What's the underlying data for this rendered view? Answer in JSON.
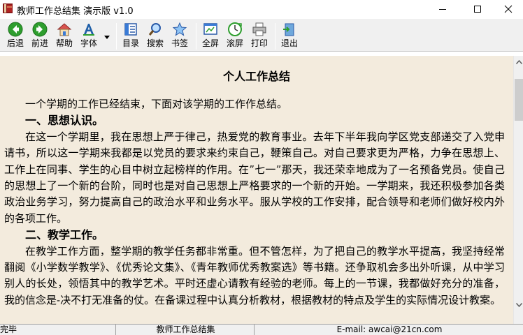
{
  "window": {
    "title": "教师工作总结集  演示版  v1.0"
  },
  "toolbar": {
    "back_label": "后退",
    "forward_label": "前进",
    "help_label": "帮助",
    "font_label": "字体",
    "contents_label": "目录",
    "search_label": "搜索",
    "bookmark_label": "书签",
    "fullscreen_label": "全屏",
    "autoscroll_label": "滚屏",
    "print_label": "打印",
    "exit_label": "退出"
  },
  "document": {
    "title": "个人工作总结",
    "paragraphs": [
      {
        "kind": "text",
        "text": "一个学期的工作已经结束，下面对该学期的工作作总结。"
      },
      {
        "kind": "heading",
        "text": "一、思想认识。"
      },
      {
        "kind": "text",
        "text": "在这一个学期里，我在思想上严于律己，热爱党的教育事业。去年下半年我向学区党支部递交了入党申请书，所以这一学期来我都是以党员的要求来约束自己，鞭策自己。对自己要求更为严格，力争在思想上、工作上在同事、学生的心目中树立起榜样的作用。在”七一”那天，我还荣幸地成为了一名预备党员。使自己的思想上了一个新的台阶，同时也是对自己思想上严格要求的一个新的开始。一学期来，我还积极参加各类政治业务学习，努力提高自己的政治水平和业务水平。服从学校的工作安排，配合领导和老师们做好校内外的各项工作。"
      },
      {
        "kind": "heading",
        "text": "二、教学工作。"
      },
      {
        "kind": "text",
        "text": "在教学工作方面，整学期的教学任务都非常重。但不管怎样，为了把自己的教学水平提高，我坚持经常翻阅《小学数学教学》、《优秀论文集》、《青年教师优秀教案选》等书籍。还争取机会多出外听课，从中学习别人的长处，领悟其中的教学艺术。平时还虚心请教有经验的老师。每上的一节课，我都做好充分的准备，我的信念是-决不打无准备的仗。在备课过程中认真分析教材，根据教材的特点及学生的实际情况设计教案。"
      }
    ]
  },
  "statusbar": {
    "status": "完毕",
    "app_name": "教师工作总结集",
    "email": "E-mail: awcai@21cn.com"
  },
  "colors": {
    "content_bg": "#f3ebdd",
    "chrome_bg": "#f0f0f0",
    "arrow_green": "#2e9e2e"
  }
}
